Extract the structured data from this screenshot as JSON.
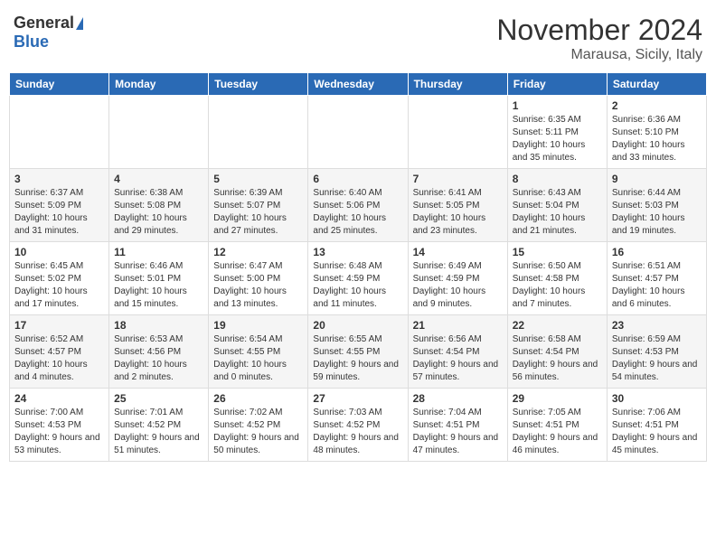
{
  "logo": {
    "general": "General",
    "blue": "Blue"
  },
  "title": "November 2024",
  "subtitle": "Marausa, Sicily, Italy",
  "days_of_week": [
    "Sunday",
    "Monday",
    "Tuesday",
    "Wednesday",
    "Thursday",
    "Friday",
    "Saturday"
  ],
  "weeks": [
    [
      {
        "day": "",
        "info": ""
      },
      {
        "day": "",
        "info": ""
      },
      {
        "day": "",
        "info": ""
      },
      {
        "day": "",
        "info": ""
      },
      {
        "day": "",
        "info": ""
      },
      {
        "day": "1",
        "info": "Sunrise: 6:35 AM\nSunset: 5:11 PM\nDaylight: 10 hours and 35 minutes."
      },
      {
        "day": "2",
        "info": "Sunrise: 6:36 AM\nSunset: 5:10 PM\nDaylight: 10 hours and 33 minutes."
      }
    ],
    [
      {
        "day": "3",
        "info": "Sunrise: 6:37 AM\nSunset: 5:09 PM\nDaylight: 10 hours and 31 minutes."
      },
      {
        "day": "4",
        "info": "Sunrise: 6:38 AM\nSunset: 5:08 PM\nDaylight: 10 hours and 29 minutes."
      },
      {
        "day": "5",
        "info": "Sunrise: 6:39 AM\nSunset: 5:07 PM\nDaylight: 10 hours and 27 minutes."
      },
      {
        "day": "6",
        "info": "Sunrise: 6:40 AM\nSunset: 5:06 PM\nDaylight: 10 hours and 25 minutes."
      },
      {
        "day": "7",
        "info": "Sunrise: 6:41 AM\nSunset: 5:05 PM\nDaylight: 10 hours and 23 minutes."
      },
      {
        "day": "8",
        "info": "Sunrise: 6:43 AM\nSunset: 5:04 PM\nDaylight: 10 hours and 21 minutes."
      },
      {
        "day": "9",
        "info": "Sunrise: 6:44 AM\nSunset: 5:03 PM\nDaylight: 10 hours and 19 minutes."
      }
    ],
    [
      {
        "day": "10",
        "info": "Sunrise: 6:45 AM\nSunset: 5:02 PM\nDaylight: 10 hours and 17 minutes."
      },
      {
        "day": "11",
        "info": "Sunrise: 6:46 AM\nSunset: 5:01 PM\nDaylight: 10 hours and 15 minutes."
      },
      {
        "day": "12",
        "info": "Sunrise: 6:47 AM\nSunset: 5:00 PM\nDaylight: 10 hours and 13 minutes."
      },
      {
        "day": "13",
        "info": "Sunrise: 6:48 AM\nSunset: 4:59 PM\nDaylight: 10 hours and 11 minutes."
      },
      {
        "day": "14",
        "info": "Sunrise: 6:49 AM\nSunset: 4:59 PM\nDaylight: 10 hours and 9 minutes."
      },
      {
        "day": "15",
        "info": "Sunrise: 6:50 AM\nSunset: 4:58 PM\nDaylight: 10 hours and 7 minutes."
      },
      {
        "day": "16",
        "info": "Sunrise: 6:51 AM\nSunset: 4:57 PM\nDaylight: 10 hours and 6 minutes."
      }
    ],
    [
      {
        "day": "17",
        "info": "Sunrise: 6:52 AM\nSunset: 4:57 PM\nDaylight: 10 hours and 4 minutes."
      },
      {
        "day": "18",
        "info": "Sunrise: 6:53 AM\nSunset: 4:56 PM\nDaylight: 10 hours and 2 minutes."
      },
      {
        "day": "19",
        "info": "Sunrise: 6:54 AM\nSunset: 4:55 PM\nDaylight: 10 hours and 0 minutes."
      },
      {
        "day": "20",
        "info": "Sunrise: 6:55 AM\nSunset: 4:55 PM\nDaylight: 9 hours and 59 minutes."
      },
      {
        "day": "21",
        "info": "Sunrise: 6:56 AM\nSunset: 4:54 PM\nDaylight: 9 hours and 57 minutes."
      },
      {
        "day": "22",
        "info": "Sunrise: 6:58 AM\nSunset: 4:54 PM\nDaylight: 9 hours and 56 minutes."
      },
      {
        "day": "23",
        "info": "Sunrise: 6:59 AM\nSunset: 4:53 PM\nDaylight: 9 hours and 54 minutes."
      }
    ],
    [
      {
        "day": "24",
        "info": "Sunrise: 7:00 AM\nSunset: 4:53 PM\nDaylight: 9 hours and 53 minutes."
      },
      {
        "day": "25",
        "info": "Sunrise: 7:01 AM\nSunset: 4:52 PM\nDaylight: 9 hours and 51 minutes."
      },
      {
        "day": "26",
        "info": "Sunrise: 7:02 AM\nSunset: 4:52 PM\nDaylight: 9 hours and 50 minutes."
      },
      {
        "day": "27",
        "info": "Sunrise: 7:03 AM\nSunset: 4:52 PM\nDaylight: 9 hours and 48 minutes."
      },
      {
        "day": "28",
        "info": "Sunrise: 7:04 AM\nSunset: 4:51 PM\nDaylight: 9 hours and 47 minutes."
      },
      {
        "day": "29",
        "info": "Sunrise: 7:05 AM\nSunset: 4:51 PM\nDaylight: 9 hours and 46 minutes."
      },
      {
        "day": "30",
        "info": "Sunrise: 7:06 AM\nSunset: 4:51 PM\nDaylight: 9 hours and 45 minutes."
      }
    ]
  ]
}
